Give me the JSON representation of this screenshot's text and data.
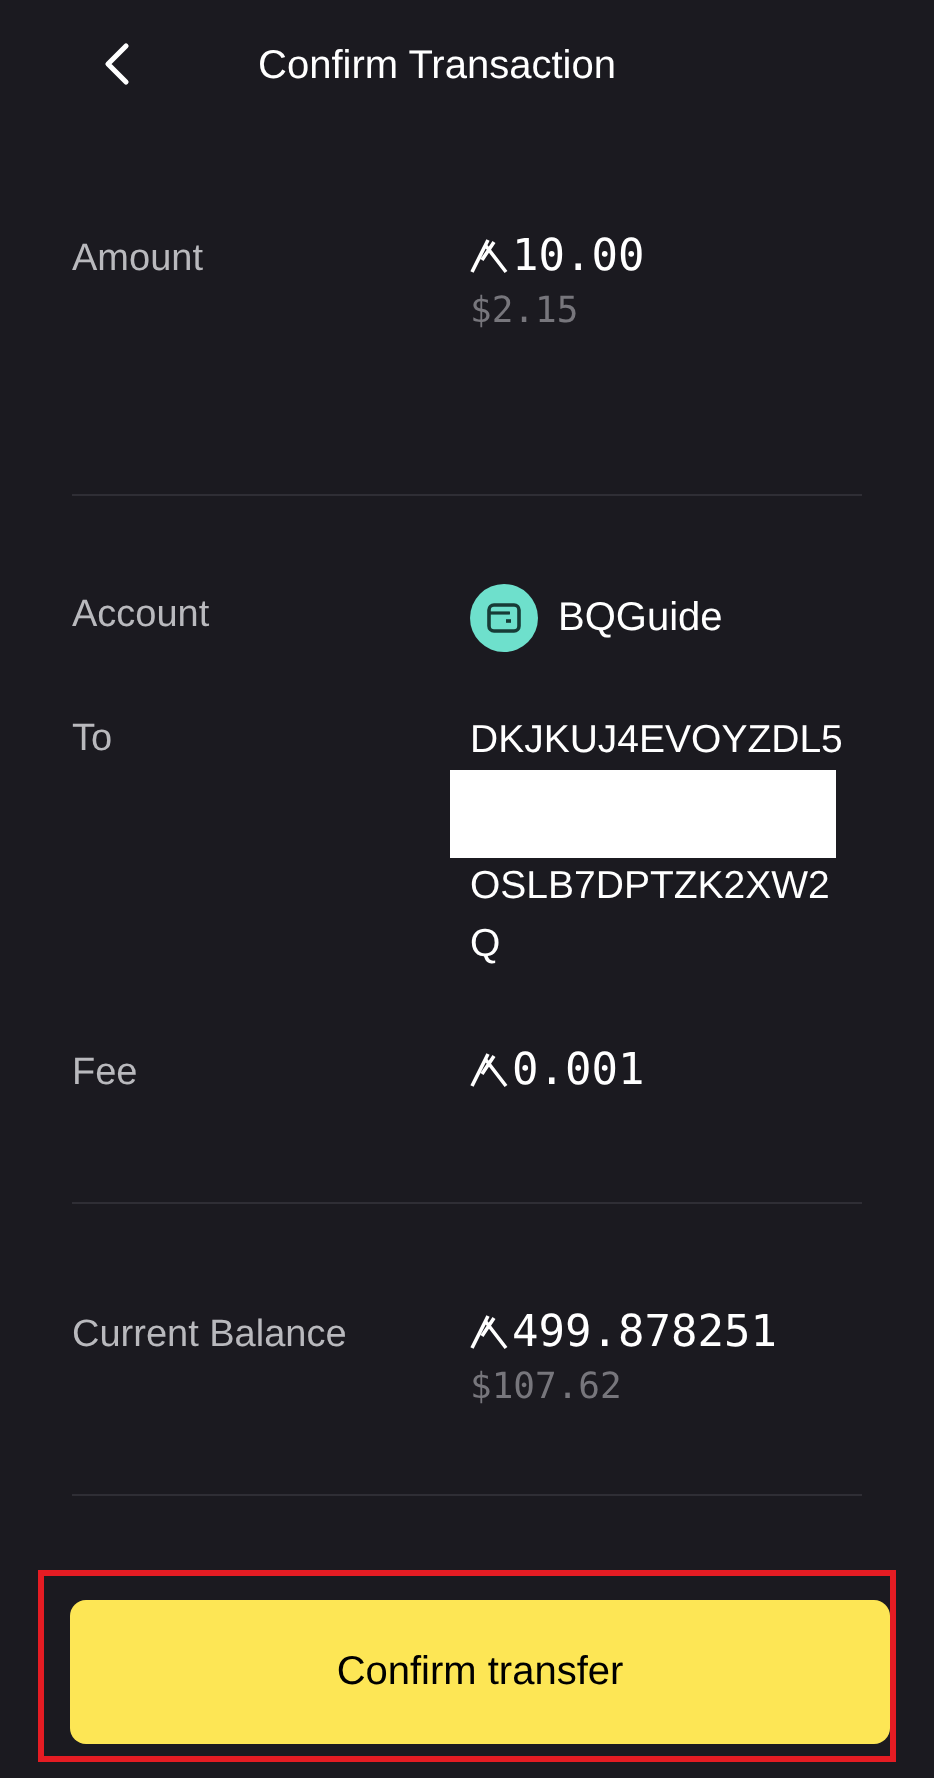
{
  "header": {
    "title": "Confirm Transaction"
  },
  "groups": [
    {
      "rows": [
        {
          "kind": "amount",
          "label": "Amount",
          "value": "10.00",
          "fiat": "$2.15"
        }
      ]
    },
    {
      "rows": [
        {
          "kind": "account",
          "label": "Account",
          "value": "BQGuide"
        },
        {
          "kind": "address",
          "label": "To",
          "lines": [
            {
              "kind": "text",
              "text": "DKJKUJ4EVOYZDL5"
            },
            {
              "kind": "redacted"
            },
            {
              "kind": "text",
              "text": "OSLB7DPTZK2XW2"
            },
            {
              "kind": "text",
              "text": "Q"
            }
          ]
        },
        {
          "kind": "amount",
          "label": "Fee",
          "value": "0.001"
        }
      ]
    },
    {
      "rows": [
        {
          "kind": "amount",
          "label": "Current Balance",
          "value": "499.878251",
          "fiat": "$107.62"
        }
      ]
    }
  ],
  "button": {
    "label": "Confirm transfer",
    "highlighted": true
  }
}
